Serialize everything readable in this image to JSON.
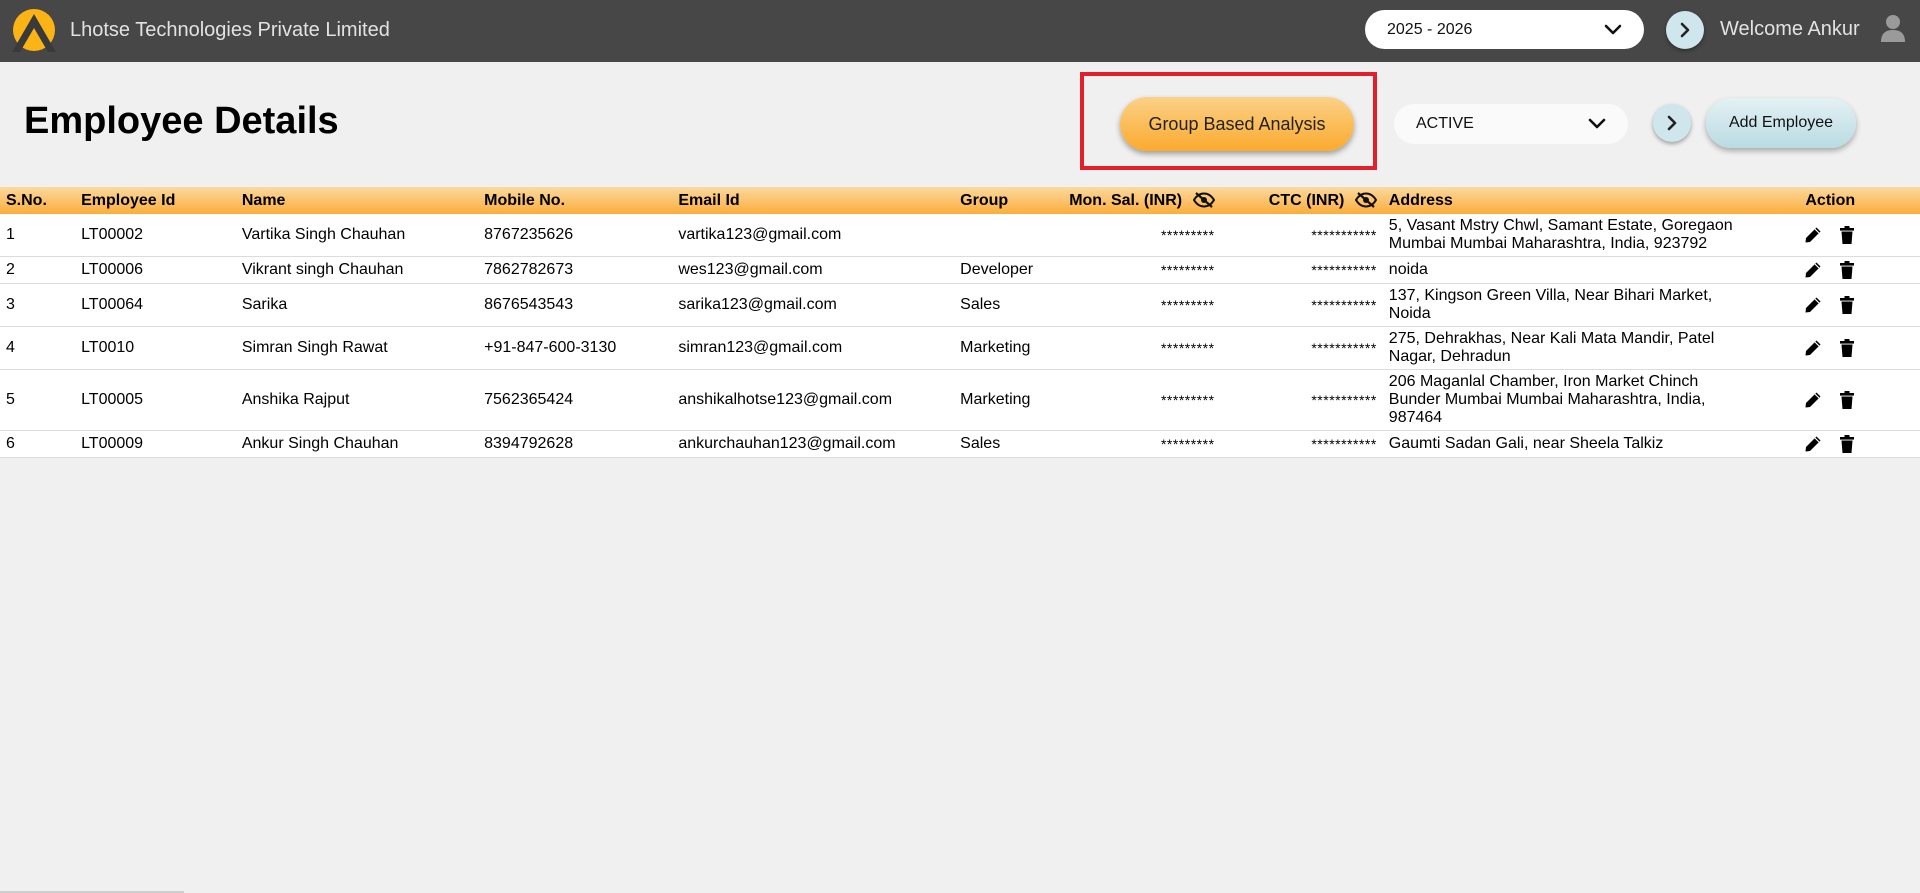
{
  "header": {
    "company_name": "Lhotse Technologies Private Limited",
    "financial_year": "2025 - 2026",
    "welcome_text": "Welcome Ankur",
    "colors": {
      "bar": "#474747",
      "accent": "#fbae3b"
    }
  },
  "page": {
    "title": "Employee Details",
    "group_analysis_label": "Group Based Analysis",
    "status_filter": "ACTIVE",
    "add_employee_label": "Add Employee"
  },
  "table": {
    "columns": [
      "S.No.",
      "Employee Id",
      "Name",
      "Mobile No.",
      "Email Id",
      "Group",
      "Mon. Sal. (INR)",
      "CTC (INR)",
      "Address",
      "Action"
    ],
    "rows": [
      {
        "sno": "1",
        "id": "LT00002",
        "name": "Vartika Singh Chauhan",
        "mobile": "8767235626",
        "email": "vartika123@gmail.com",
        "group": "",
        "salary": "*********",
        "ctc": "***********",
        "address": "5, Vasant Mstry Chwl, Samant Estate, Goregaon Mumbai Mumbai Maharashtra, India, 923792"
      },
      {
        "sno": "2",
        "id": "LT00006",
        "name": "Vikrant singh Chauhan",
        "mobile": "7862782673",
        "email": "wes123@gmail.com",
        "group": "Developer",
        "salary": "*********",
        "ctc": "***********",
        "address": "noida"
      },
      {
        "sno": "3",
        "id": "LT00064",
        "name": "Sarika",
        "mobile": "8676543543",
        "email": "sarika123@gmail.com",
        "group": "Sales",
        "salary": "*********",
        "ctc": "***********",
        "address": "137, Kingson Green Villa, Near Bihari Market, Noida"
      },
      {
        "sno": "4",
        "id": "LT0010",
        "name": "Simran Singh Rawat",
        "mobile": "+91-847-600-3130",
        "email": "simran123@gmail.com",
        "group": "Marketing",
        "salary": "*********",
        "ctc": "***********",
        "address": "275, Dehrakhas, Near Kali Mata Mandir, Patel Nagar, Dehradun"
      },
      {
        "sno": "5",
        "id": "LT00005",
        "name": "Anshika Rajput",
        "mobile": "7562365424",
        "email": "anshikalhotse123@gmail.com",
        "group": "Marketing",
        "salary": "*********",
        "ctc": "***********",
        "address": "206 Maganlal Chamber, Iron Market Chinch Bunder Mumbai Mumbai Maharashtra, India, 987464"
      },
      {
        "sno": "6",
        "id": "LT00009",
        "name": "Ankur Singh Chauhan",
        "mobile": "8394792628",
        "email": "ankurchauhan123@gmail.com",
        "group": "Sales",
        "salary": "*********",
        "ctc": "***********",
        "address": "Gaumti Sadan Gali, near Sheela Talkiz"
      }
    ]
  },
  "icons": {
    "logo": "mountain-logo-icon",
    "dropdown": "chevron-down-icon",
    "next": "chevron-right-icon",
    "user": "user-icon",
    "hidden": "eye-slash-icon",
    "edit": "pencil-icon",
    "delete": "trash-icon"
  }
}
